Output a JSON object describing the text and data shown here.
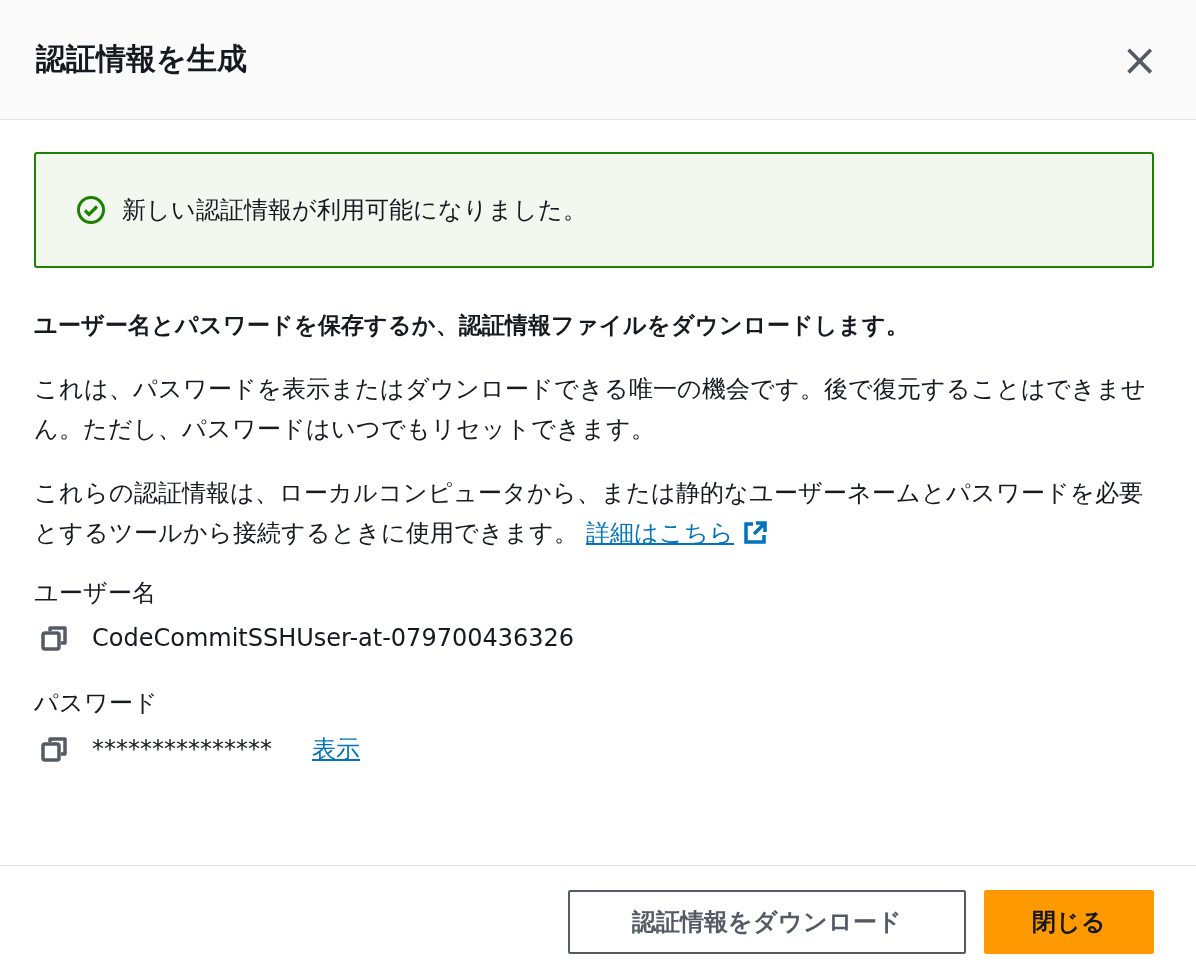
{
  "dialog": {
    "title": "認証情報を生成",
    "close": "×"
  },
  "alert": {
    "kind": "success",
    "message": "新しい認証情報が利用可能になりました。"
  },
  "heading": "ユーザー名とパスワードを保存するか、認証情報ファイルをダウンロードします。",
  "paragraphs": [
    {
      "text": "これは、パスワードを表示またはダウンロードできる唯一の機会です。後で復元することはできません。ただし、パスワードはいつでもリセットできます。"
    },
    {
      "text": "これらの認証情報は、ローカルコンピュータから、または静的なユーザーネームとパスワードを必要とするツールから接続するときに使用できます。",
      "link": "詳細はこちら"
    }
  ],
  "fields": [
    {
      "label": "ユーザー名",
      "value": "CodeCommitSSHUser-at-079700436326"
    },
    {
      "label": "パスワード",
      "value": "***************",
      "action": "表示"
    }
  ],
  "buttons": [
    {
      "label": "認証情報をダウンロード",
      "kind": "secondary"
    },
    {
      "label": "閉じる",
      "kind": "primary"
    }
  ]
}
